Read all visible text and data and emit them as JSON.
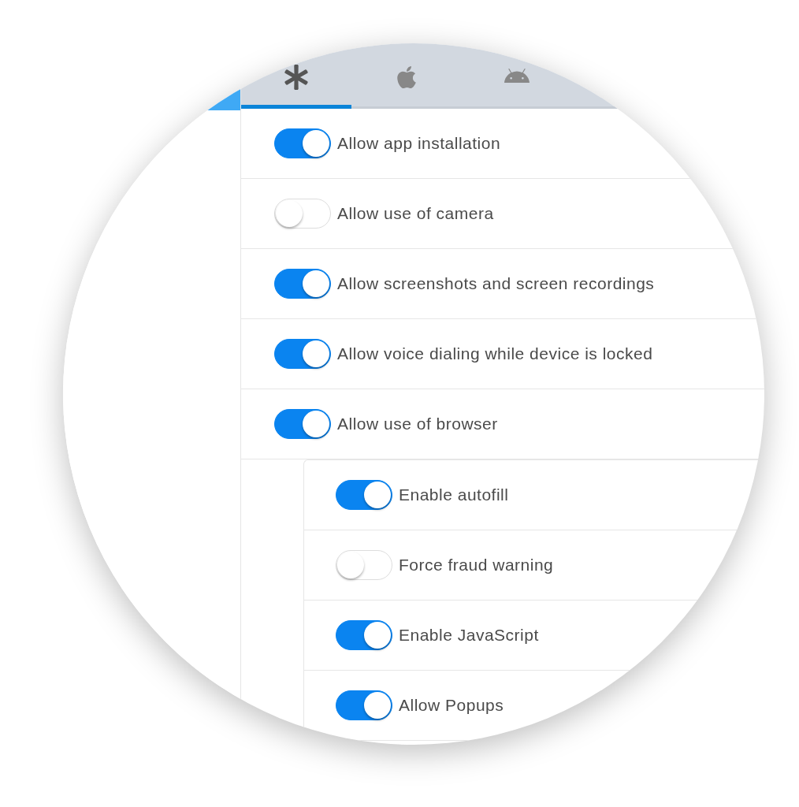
{
  "sidebar": {
    "items": [
      {
        "selected": true
      }
    ]
  },
  "tabs": [
    {
      "kind": "asterisk",
      "selected": true
    },
    {
      "kind": "apple",
      "selected": false
    },
    {
      "kind": "android",
      "selected": false
    }
  ],
  "settings": [
    {
      "label": "Allow app installation",
      "on": true
    },
    {
      "label": "Allow use of camera",
      "on": false
    },
    {
      "label": "Allow screenshots and screen recordings",
      "on": true
    },
    {
      "label": "Allow voice dialing while device is locked",
      "on": true
    },
    {
      "label": "Allow use of browser",
      "on": true,
      "children": [
        {
          "label": "Enable autofill",
          "on": true
        },
        {
          "label": "Force fraud warning",
          "on": false
        },
        {
          "label": "Enable JavaScript",
          "on": true
        },
        {
          "label": "Allow Popups",
          "on": true
        }
      ]
    }
  ]
}
